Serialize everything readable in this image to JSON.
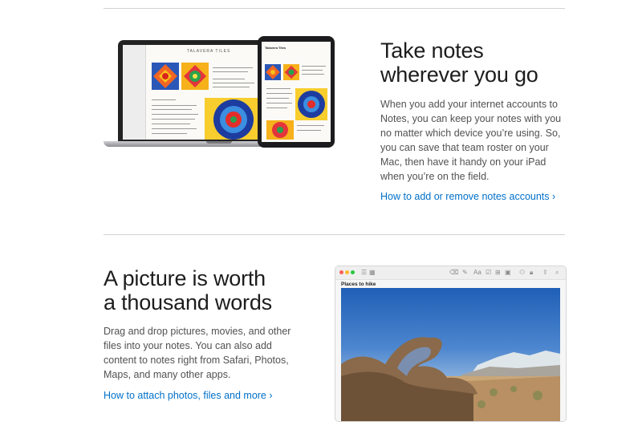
{
  "section1": {
    "title_line1": "Take notes",
    "title_line2": "wherever you go",
    "body": "When you add your internet accounts to Notes, you can keep your notes with you no matter which device you’re using. So, you can save that team roster on your Mac, then have it handy on your iPad when you’re on the field.",
    "link": "How to add or remove notes accounts ›",
    "devices": {
      "laptop_note_title": "TALAVERA TILES",
      "ipad_note_title": "Talavera Tiles"
    }
  },
  "section2": {
    "title_line1": "A picture is worth",
    "title_line2": "a thousand words",
    "body": "Drag and drop pictures, movies, and other files into your notes. You can also add content to notes right from Safari, Photos, Maps, and many other apps.",
    "link": "How to attach photos, files and more ›",
    "window": {
      "note_title": "Places to hike",
      "toolbar_icons": [
        "trash-icon",
        "compose-icon",
        "format-icon",
        "checklist-icon",
        "table-icon",
        "media-icon",
        "lock-icon",
        "share-icon",
        "search-icon"
      ]
    }
  },
  "colors": {
    "link": "#0070c9",
    "heading": "#1d1d1f",
    "body": "#515154",
    "divider": "#d2d2d7"
  }
}
